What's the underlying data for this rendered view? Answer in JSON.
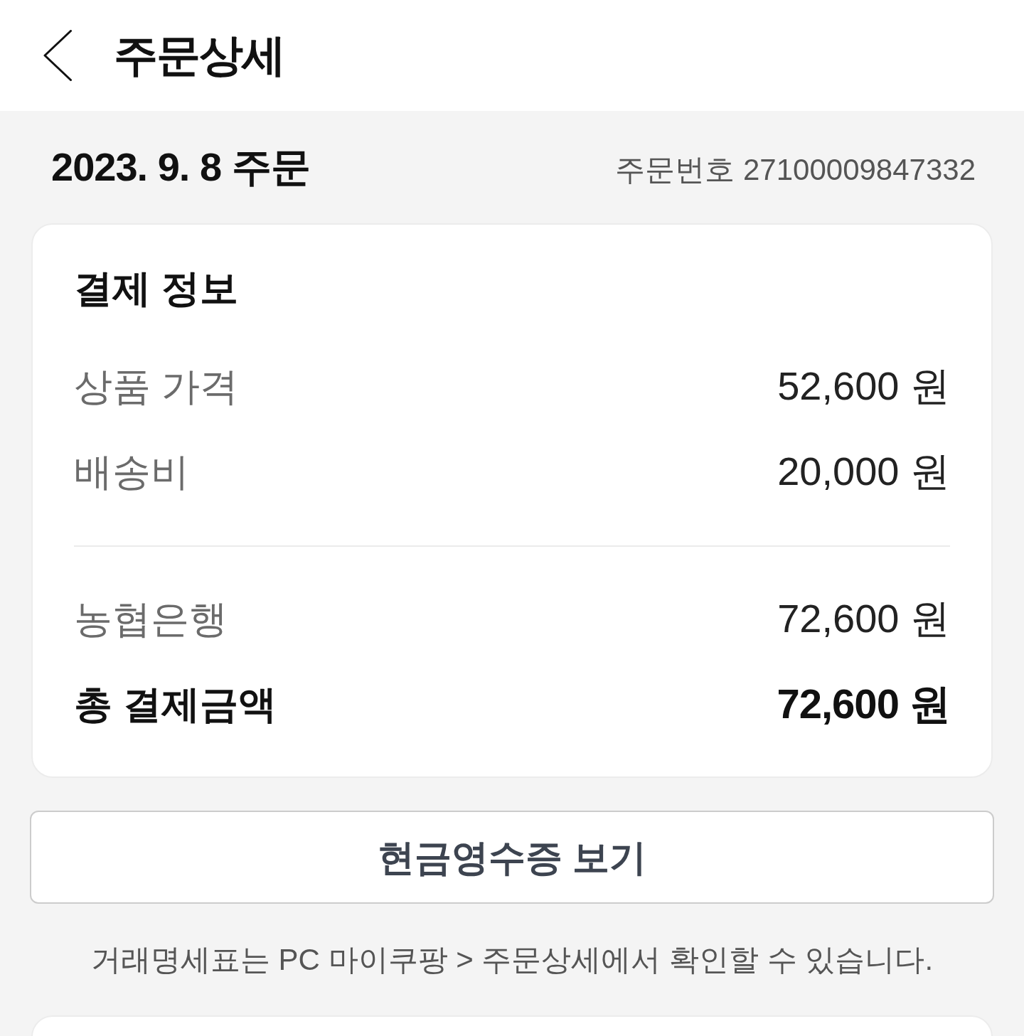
{
  "header": {
    "title": "주문상세"
  },
  "order": {
    "date": "2023. 9. 8 주문",
    "number": "주문번호 27100009847332"
  },
  "payment": {
    "title": "결제 정보",
    "sections": [
      {
        "rows": [
          {
            "kind": "normal",
            "label": "상품 가격",
            "value": "52,600 원"
          },
          {
            "kind": "normal",
            "label": "배송비",
            "value": "20,000 원"
          }
        ]
      },
      {
        "rows": [
          {
            "kind": "normal",
            "label": "농협은행",
            "value": "72,600 원"
          },
          {
            "kind": "total",
            "label": "총 결제금액",
            "value": "72,600 원"
          }
        ]
      }
    ]
  },
  "receipt_button": {
    "label": "현금영수증 보기"
  },
  "notice": "거래명세표는 PC 마이쿠팡 > 주문상세에서 확인할 수 있습니다."
}
